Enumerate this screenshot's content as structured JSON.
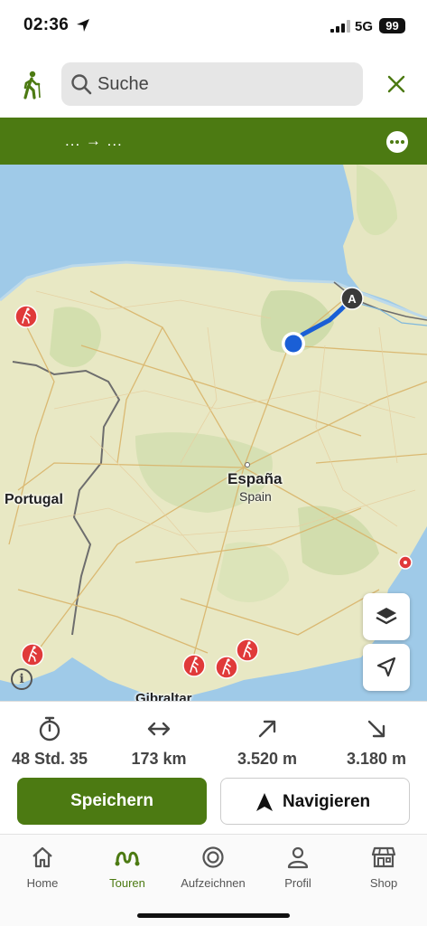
{
  "status_bar": {
    "time": "02:36",
    "network": "5G",
    "battery": "99"
  },
  "search": {
    "placeholder": "Suche"
  },
  "route_header": {
    "title": "... → ..."
  },
  "map": {
    "labels": {
      "espana": "España",
      "spain": "Spain",
      "portugal": "Portugal",
      "gibraltar": "Gibraltar"
    },
    "start_marker": "A",
    "info": "i"
  },
  "stats": {
    "duration": "48 Std. 35",
    "distance": "173 km",
    "ascent": "3.520 m",
    "descent": "3.180 m"
  },
  "actions": {
    "save_label": "Speichern",
    "navigate_label": "Navigieren"
  },
  "tabs": [
    {
      "label": "Home",
      "icon": "home-icon"
    },
    {
      "label": "Touren",
      "icon": "tours-icon"
    },
    {
      "label": "Aufzeichnen",
      "icon": "record-icon"
    },
    {
      "label": "Profil",
      "icon": "profile-icon"
    },
    {
      "label": "Shop",
      "icon": "shop-icon"
    }
  ],
  "colors": {
    "brand_green": "#4c7a12",
    "route_blue": "#1a5fd6",
    "poi_red": "#e03a3a",
    "sea": "#9fcae8",
    "land": "#e8e8c4"
  }
}
